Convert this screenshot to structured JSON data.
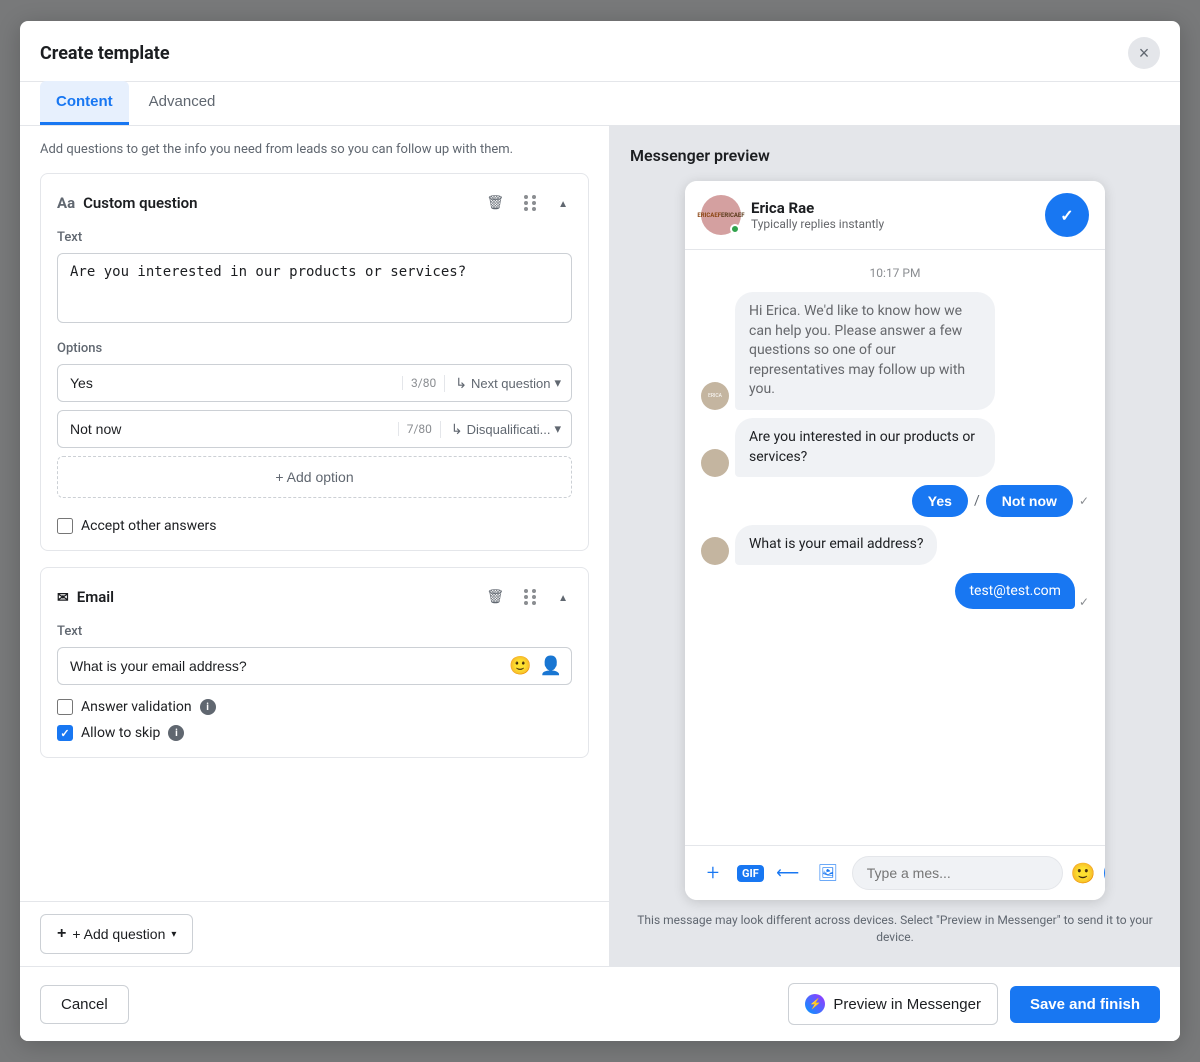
{
  "modal": {
    "title": "Create template",
    "close_label": "×"
  },
  "tabs": {
    "content_label": "Content",
    "advanced_label": "Advanced"
  },
  "left_panel": {
    "intro_text": "Add questions to get the info you need from leads so you can follow up with them.",
    "custom_question": {
      "title": "Custom question",
      "text_label": "Text",
      "text_value": "Are you interested in our products or services?",
      "options_label": "Options",
      "options": [
        {
          "label": "Yes",
          "count": "3/80",
          "action": "Next question"
        },
        {
          "label": "Not now",
          "count": "7/80",
          "action": "Disqualificati..."
        }
      ],
      "add_option_label": "+ Add option",
      "accept_other_label": "Accept other answers"
    },
    "email_question": {
      "title": "Email",
      "text_label": "Text",
      "text_value": "What is your email address?",
      "answer_validation_label": "Answer validation",
      "allow_to_skip_label": "Allow to skip"
    },
    "add_question_label": "+ Add question"
  },
  "right_panel": {
    "preview_title": "Messenger preview",
    "chat": {
      "name": "Erica Rae",
      "status": "Typically replies instantly",
      "time": "10:17 PM",
      "messages": [
        {
          "type": "left_gray",
          "text": "Hi Erica. We'd like to know how we can help you. Please answer a few questions so one of our representatives may follow up with you."
        },
        {
          "type": "left_bold",
          "text": "Are you interested in our products or services?"
        },
        {
          "type": "options",
          "options": [
            "Yes",
            "Not now"
          ]
        },
        {
          "type": "left_bold",
          "text": "What is your email address?"
        },
        {
          "type": "right",
          "text": "test@test.com"
        }
      ],
      "input_placeholder": "Type a mes...",
      "preview_notice": "This message may look different across devices. Select \"Preview in Messenger\" to send it to your device."
    }
  },
  "footer": {
    "cancel_label": "Cancel",
    "preview_messenger_label": "Preview in Messenger",
    "save_label": "Save and finish"
  }
}
